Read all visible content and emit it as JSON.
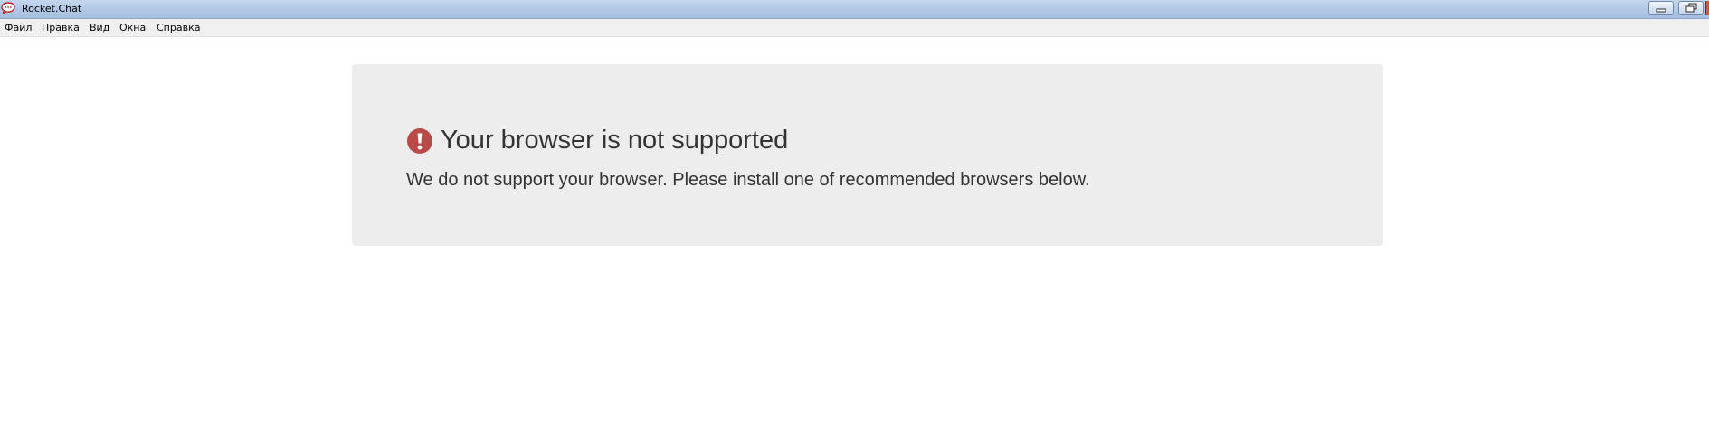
{
  "window": {
    "title": "Rocket.Chat",
    "app_icon": "speech-bubble-icon",
    "controls": [
      "minimize-icon",
      "restore-icon"
    ]
  },
  "menubar": {
    "items": [
      "Файл",
      "Правка",
      "Вид",
      "Окна",
      "Справка"
    ]
  },
  "notice": {
    "icon": "exclamation-circle-icon",
    "icon_color": "#c0392b",
    "title": "Your browser is not supported",
    "message": "We do not support your browser. Please install one of recommended browsers below."
  }
}
